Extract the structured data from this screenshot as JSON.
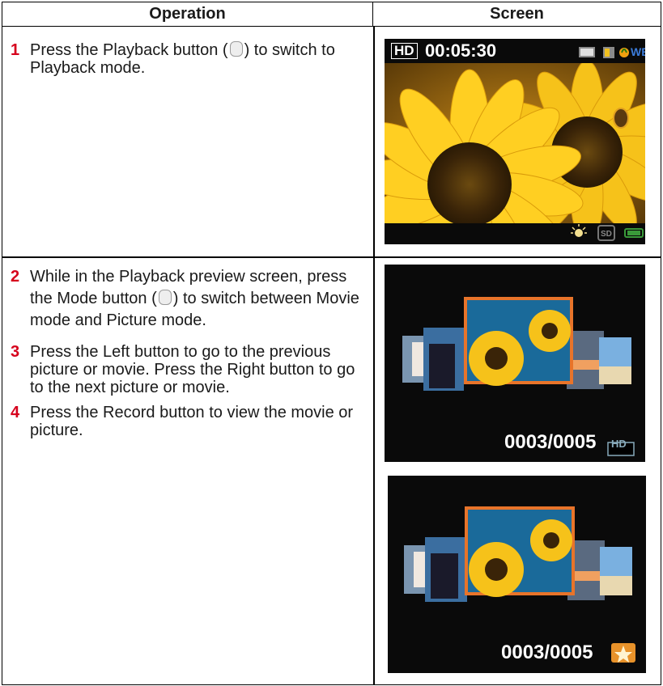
{
  "header": {
    "operation": "Operation",
    "screen": "Screen"
  },
  "steps": [
    {
      "num": "1",
      "text_before": "Press the Playback button (",
      "text_after": ") to switch to Playback mode."
    },
    {
      "num": "2",
      "text_before": "While in the Playback preview screen, press the Mode button (",
      "text_after": ") to switch between Movie mode and Picture mode."
    },
    {
      "num": "3",
      "text": "Press the Left button to go to the previous picture or movie. Press the Right button to go to the next picture or movie."
    },
    {
      "num": "4",
      "text": "Press the Record button to view the movie or picture."
    }
  ],
  "screens": {
    "playback": {
      "hd_badge": "HD",
      "timecode": "00:05:30",
      "wb_label": "WB",
      "card_label": "SD"
    },
    "movie_browser": {
      "counter": "0003/0005",
      "badge": "HD"
    },
    "picture_browser": {
      "counter": "0003/0005",
      "badge_icon": "star-icon"
    }
  },
  "colors": {
    "step_number": "#d6001c",
    "highlight_frame": "#e8742a"
  }
}
